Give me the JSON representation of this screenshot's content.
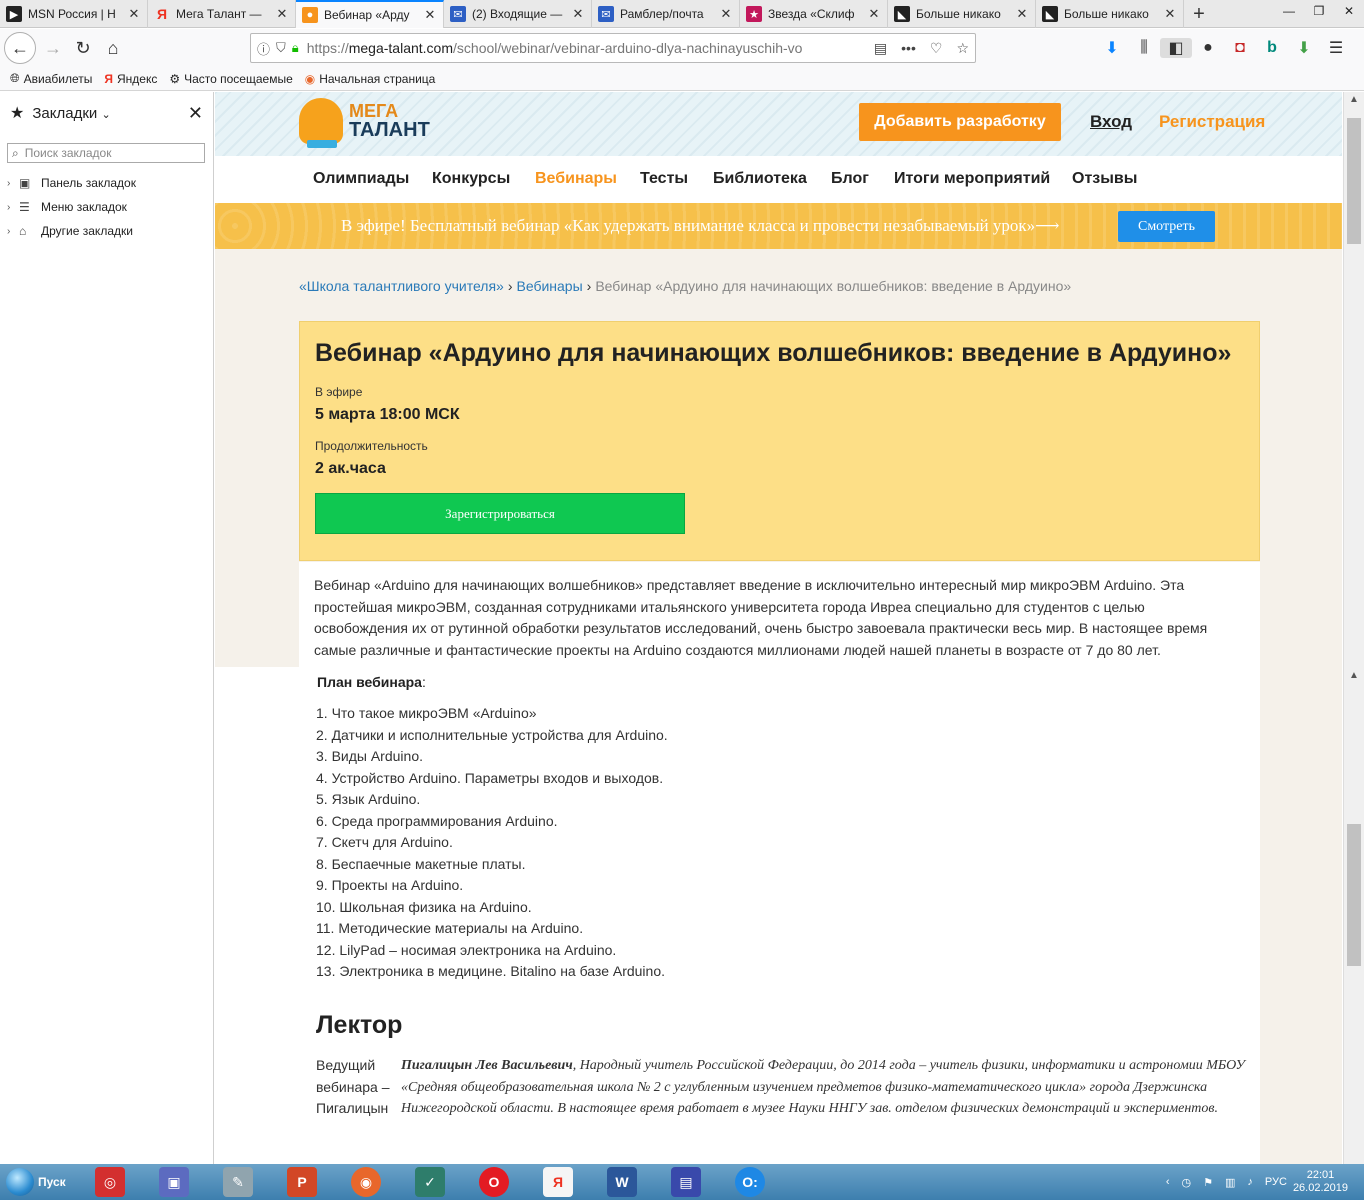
{
  "tabs": [
    {
      "label": "MSN Россия | Н",
      "icon": "msn-icon",
      "active": false
    },
    {
      "label": "Мега Талант —",
      "icon": "yandex-icon",
      "active": false
    },
    {
      "label": "Вебинар «Арду",
      "icon": "megatalant-icon",
      "active": true
    },
    {
      "label": "(2) Входящие —",
      "icon": "mail-icon",
      "active": false
    },
    {
      "label": "Рамблер/почта",
      "icon": "mail-icon",
      "active": false
    },
    {
      "label": "Звезда «Склиф",
      "icon": "star-site-icon",
      "active": false
    },
    {
      "label": "Больше никако",
      "icon": "feed-icon",
      "active": false
    },
    {
      "label": "Больше никако",
      "icon": "feed-icon",
      "active": false
    }
  ],
  "url": {
    "prefix": "https://",
    "host": "mega-talant.com",
    "path": "/school/webinar/vebinar-arduino-dlya-nachinayuschih-vo"
  },
  "bookmarks_bar": [
    {
      "label": "Авиабилеты",
      "icon": "globe-icon"
    },
    {
      "label": "Яндекс",
      "icon": "yandex-icon"
    },
    {
      "label": "Часто посещаемые",
      "icon": "gear-icon"
    },
    {
      "label": "Начальная страница",
      "icon": "firefox-icon"
    }
  ],
  "sidebar": {
    "title": "Закладки",
    "search_placeholder": "Поиск закладок",
    "items": [
      {
        "label": "Панель закладок",
        "icon": "bookmarks-toolbar-icon"
      },
      {
        "label": "Меню закладок",
        "icon": "bookmarks-menu-icon"
      },
      {
        "label": "Другие закладки",
        "icon": "folder-icon"
      }
    ]
  },
  "site": {
    "logo_line1": "МЕГА",
    "logo_line2": "ТАЛАНТ",
    "add_button": "Добавить разработку",
    "login": "Вход",
    "register": "Регистрация",
    "nav": [
      "Олимпиады",
      "Конкурсы",
      "Вебинары",
      "Тесты",
      "Библиотека",
      "Блог",
      "Итоги мероприятий",
      "Отзывы"
    ],
    "nav_active": "Вебинары",
    "banner_text": "В эфире! Бесплатный вебинар «Как удержать внимание класса и провести незабываемый урок»⟶",
    "banner_button": "Смотреть",
    "breadcrumbs": [
      "«Школа талантливого учителя»",
      "Вебинары",
      "Вебинар «Ардуино для начинающих волшебников: введение в Ардуино»"
    ]
  },
  "webinar": {
    "title": "Вебинар «Ардуино для начинающих волшебников: введение в Ардуино»",
    "air_label": "В эфире",
    "air_value": "5 марта 18:00 МСК",
    "duration_label": "Продолжительность",
    "duration_value": "2 ак.часа",
    "register_button": "Зарегистрироваться",
    "intro": "Вебинар «Arduino для начинающих волшебников» представляет введение в исключительно интересный мир микроЭВМ Arduino. Эта простейшая микроЭВМ, созданная сотрудниками итальянского университета города Ивреа специально для студентов с целью освобождения их от рутинной обработки результатов исследований, очень быстро завоевала практически весь мир. В настоящее время самые различные и фантастические проекты на Arduino создаются миллионами людей нашей планеты в возрасте от 7 до 80 лет.",
    "plan_heading": "План вебинара",
    "plan_colon": ":",
    "plan": [
      "1. Что такое микроЭВМ «Arduino»",
      "2. Датчики и исполнительные устройства для Arduino.",
      "3. Виды Arduino.",
      "4. Устройство Arduino. Параметры входов и выходов.",
      "5. Язык Arduino.",
      "6. Среда программирования Arduino.",
      "7. Скетч для Arduino.",
      "8. Беспаечные макетные платы.",
      "9. Проекты на Arduino.",
      "10. Школьная физика на Arduino.",
      "11. Методические материалы на Arduino.",
      "12. LilyPad – носимая электроника на Arduino.",
      "13. Электроника в медицине. Bitalino на базе Arduino."
    ],
    "lector_heading": "Лектор",
    "lector_role": "Ведущий вебинара – Пигалицын",
    "lector_name": "Пигалицын Лев Васильевич",
    "lector_desc": ", Народный учитель Российской Федерации, до 2014 года – учитель физики, информатики и астрономии МБОУ «Средняя общеобразовательная школа № 2 с углубленным изучением предметов физико-математического цикла» города Дзержинска Нижегородской области. В настоящее время работает в музее Науки ННГУ зав. отделом физических демонстраций и экспериментов."
  },
  "taskbar": {
    "start_label": "Пуск",
    "apps": [
      "app-filemanager-icon",
      "app-viewer-icon",
      "app-paint-icon",
      "powerpoint-icon",
      "firefox-icon",
      "app-pen-icon",
      "opera-icon",
      "yandex-browser-icon",
      "word-icon",
      "save-disk-icon",
      "app-o-icon"
    ],
    "lang": "РУС",
    "time": "22:01",
    "date": "26.02.2019"
  },
  "colors": {
    "accent_orange": "#f7941d",
    "card_yellow": "#fddf87",
    "register_green": "#0fc851",
    "link_blue": "#2a7ab8"
  }
}
